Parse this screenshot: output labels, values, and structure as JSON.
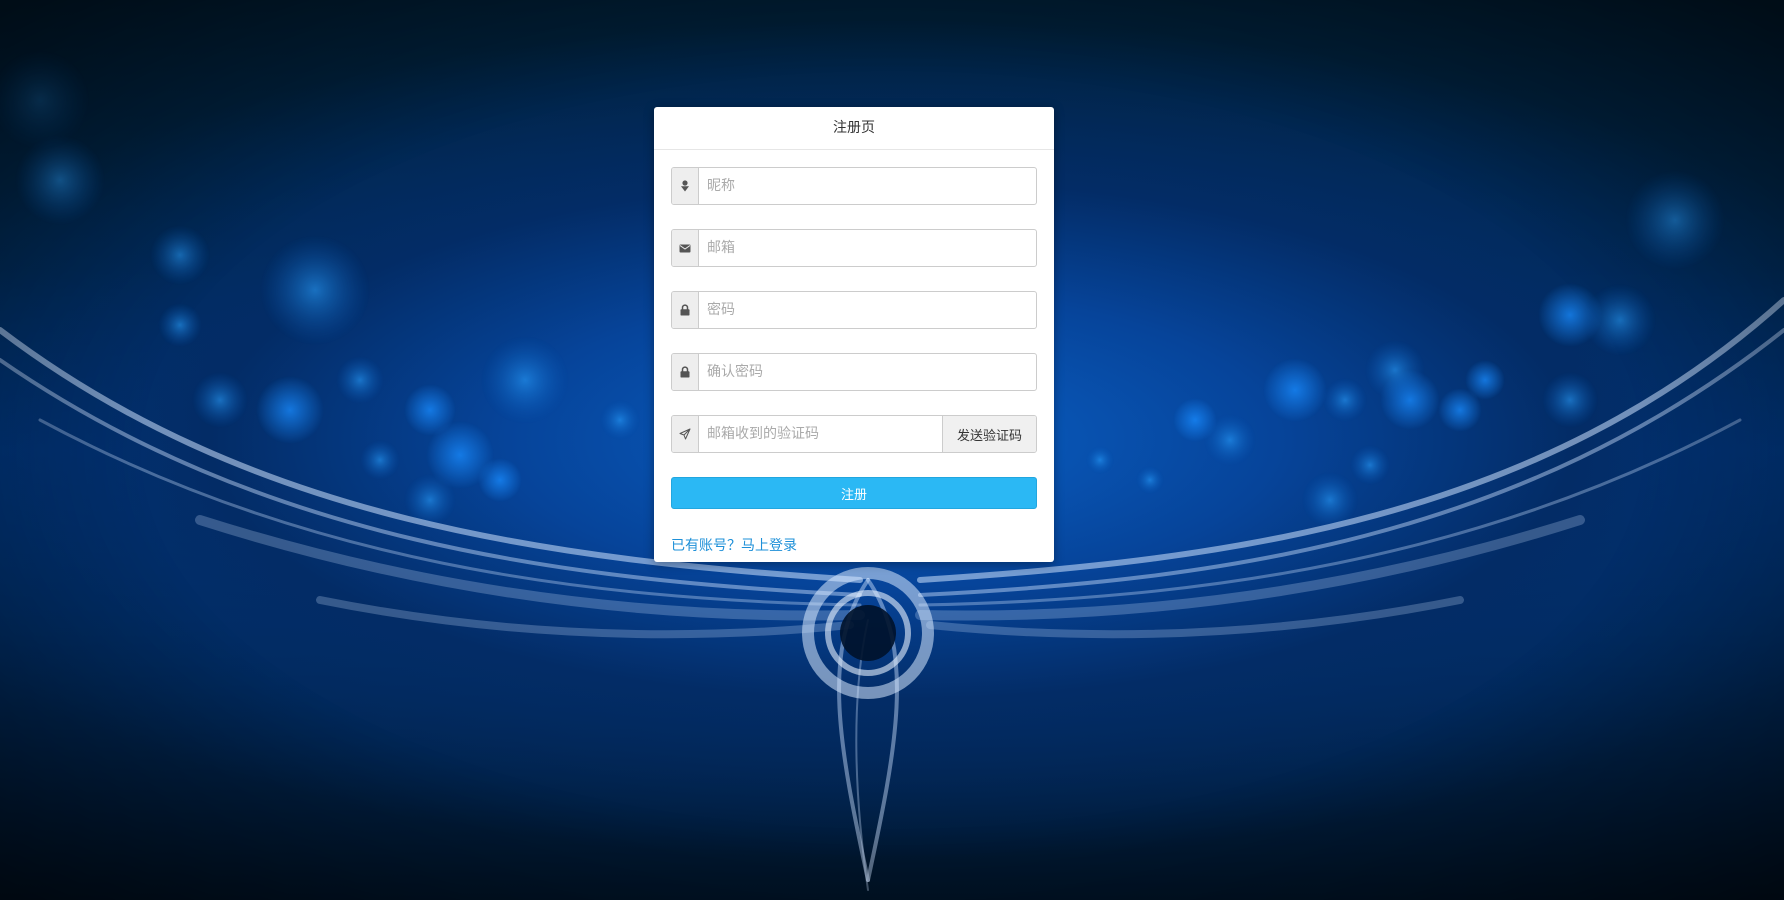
{
  "form": {
    "title": "注册页",
    "fields": [
      {
        "placeholder": "昵称",
        "value": "",
        "icon": "user-icon"
      },
      {
        "placeholder": "邮箱",
        "value": "",
        "icon": "envelope-icon"
      },
      {
        "placeholder": "密码",
        "value": "",
        "icon": "lock-icon"
      },
      {
        "placeholder": "确认密码",
        "value": "",
        "icon": "lock-icon"
      },
      {
        "placeholder": "邮箱收到的验证码",
        "value": "",
        "icon": "send-icon"
      }
    ],
    "send_code_label": "发送验证码",
    "submit_label": "注册",
    "login_link": "已有账号？马上登录"
  },
  "colors": {
    "primary": "#2bb8f4",
    "link": "#1e90d8",
    "background": "#003a85"
  }
}
